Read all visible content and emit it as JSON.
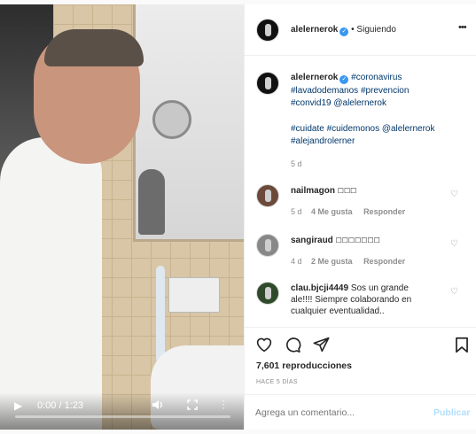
{
  "video": {
    "time": "0:00 / 1:23",
    "progress": 0.0
  },
  "header": {
    "username": "alelernerok",
    "verified": "✓",
    "following": "• Siguiendo",
    "more": "•••"
  },
  "caption": {
    "username": "alelernerok",
    "line1": "#coronavirus",
    "line2": "#lavadodemanos #prevencion",
    "line3": "#convid19 @alelernerok",
    "line4": "#cuidate #cuidemonos @alelernerok",
    "line5": "#alejandrolerner",
    "age": "5 d"
  },
  "comments": [
    {
      "username": "nailmagon",
      "text": "☐☐☐",
      "age": "5 d",
      "likes": "4 Me gusta",
      "reply": "Responder"
    },
    {
      "username": "sangiraud",
      "text": "☐☐☐☐☐☐☐",
      "age": "4 d",
      "likes": "2 Me gusta",
      "reply": "Responder"
    },
    {
      "username": "clau.bjcji4449",
      "text_line1": "Sos un grande",
      "text_line2": "ale!!!! Siempre colaborando en",
      "text_line3": "cualquier eventualidad.."
    }
  ],
  "stats": {
    "views": "7,601 reproducciones",
    "date": "HACE 5 DÍAS"
  },
  "composer": {
    "placeholder": "Agrega un comentario...",
    "publish": "Publicar"
  },
  "colors": {
    "link": "#00376b",
    "verified": "#3897f0",
    "publish_disabled": "#b2dffc"
  }
}
